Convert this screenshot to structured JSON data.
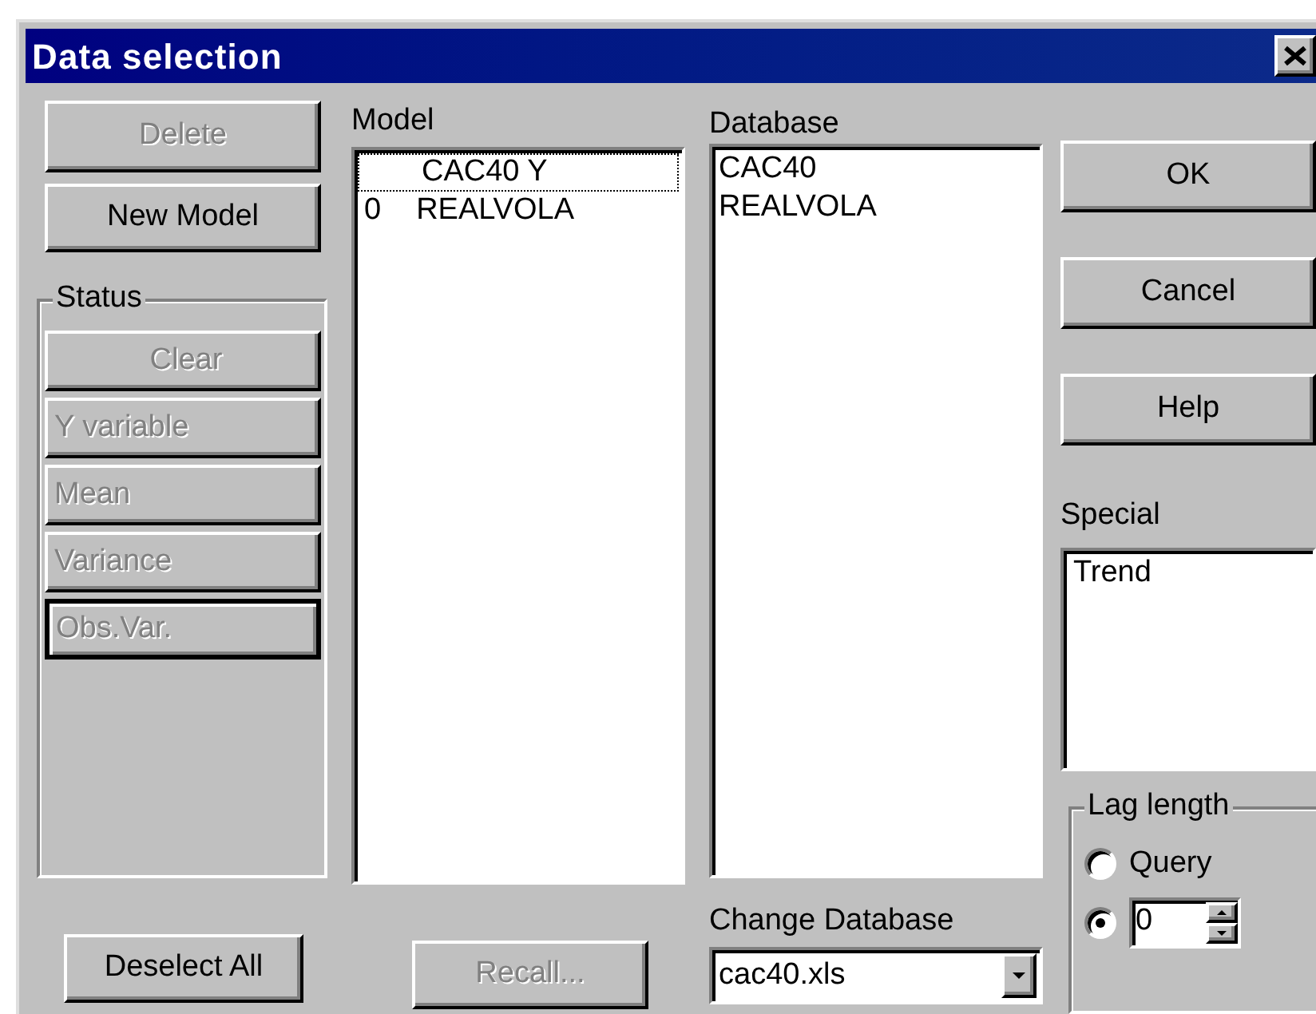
{
  "window": {
    "title": "Data selection"
  },
  "buttons": [
    {
      "label": "Delete",
      "disabled": true
    },
    {
      "label": "New Model",
      "disabled": false
    }
  ],
  "status_group": {
    "label": "Status",
    "buttons": [
      {
        "label": "Clear",
        "disabled": true,
        "focused": false
      },
      {
        "label": "Y variable",
        "disabled": true,
        "focused": false
      },
      {
        "label": "Mean",
        "disabled": true,
        "focused": false
      },
      {
        "label": "Variance",
        "disabled": true,
        "focused": false
      },
      {
        "label": "Obs.Var.",
        "disabled": true,
        "focused": true
      }
    ]
  },
  "model": {
    "label": "Model",
    "items": [
      {
        "name": "CAC40 Y",
        "selected": true
      },
      {
        "marker": "0",
        "name": "REALVOLA",
        "selected": false
      }
    ]
  },
  "database": {
    "label": "Database",
    "items": [
      {
        "name": "CAC40"
      },
      {
        "name": "REALVOLA"
      }
    ]
  },
  "dialog_buttons": [
    {
      "label": "OK"
    },
    {
      "label": "Cancel"
    },
    {
      "label": "Help"
    }
  ],
  "special": {
    "label": "Special",
    "items": [
      "Trend"
    ]
  },
  "lag_length": {
    "label": "Lag length",
    "options": [
      {
        "kind": "label",
        "label": "Query",
        "selected": false
      },
      {
        "kind": "spin",
        "value": "0",
        "selected": true
      }
    ]
  },
  "change_database": {
    "label": "Change Database",
    "value": "cac40.xls"
  },
  "bottom_buttons": [
    {
      "label": "Deselect All",
      "disabled": false
    },
    {
      "label": "Recall...",
      "disabled": true
    }
  ]
}
